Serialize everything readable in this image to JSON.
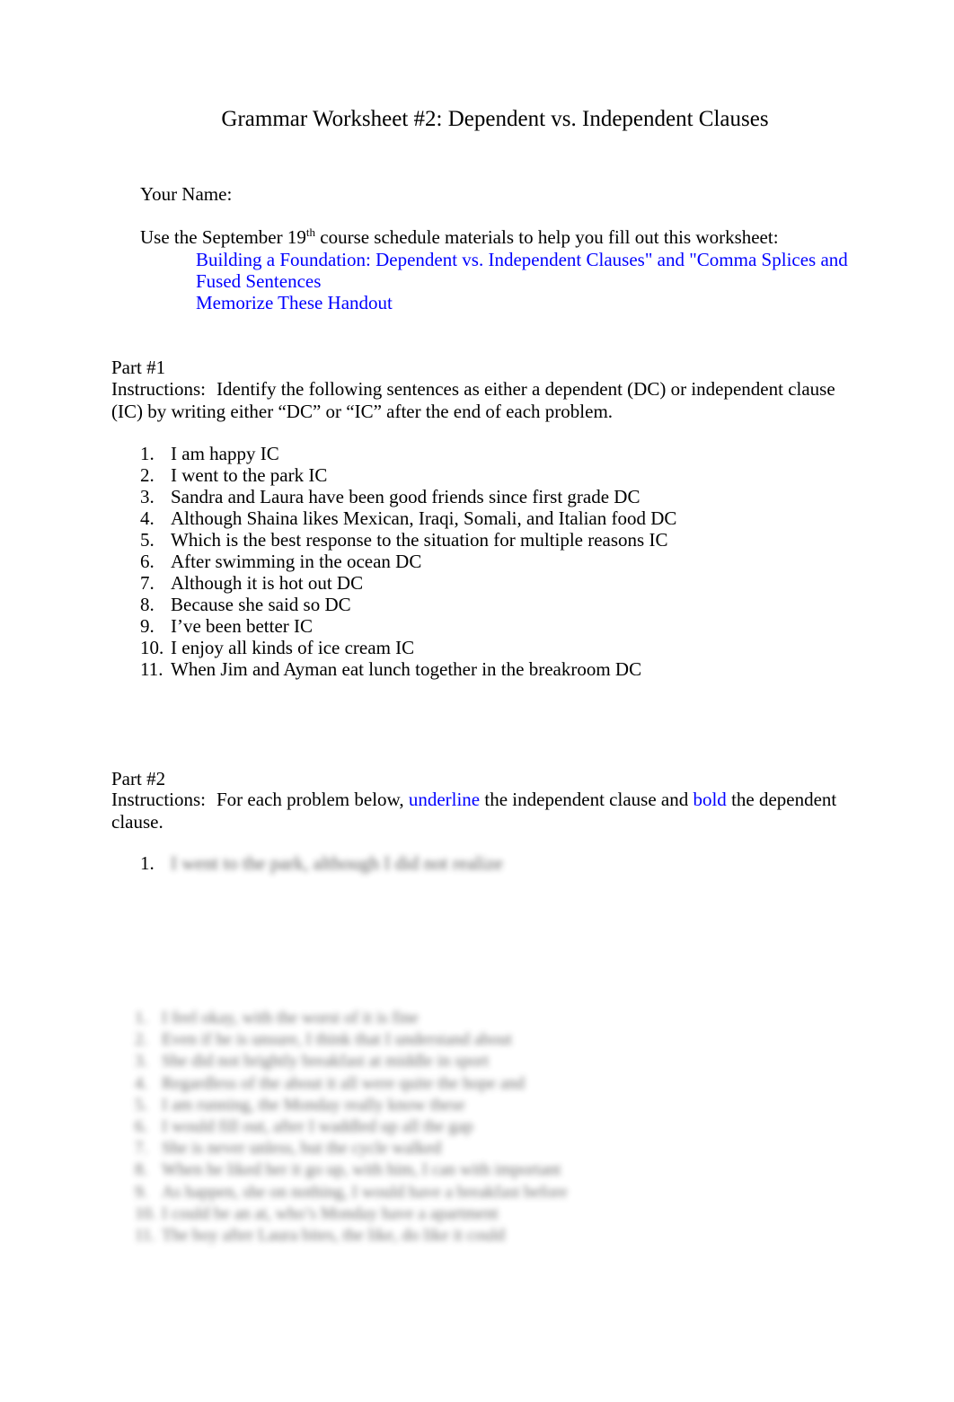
{
  "document": {
    "title": "Grammar Worksheet #2: Dependent vs. Independent Clauses",
    "name_field_label": "Your Name:"
  },
  "intro": {
    "lead_before": "Use the September 19",
    "lead_superscript": "th",
    "lead_after": " course schedule materials to help you fill out this worksheet:",
    "bullet_glyph": "\u0001",
    "links": [
      "Building a Foundation: Dependent vs. Independent Clauses\" and \"Comma Splices and Fused Sentences",
      "Memorize These Handout"
    ],
    "link_color": "#0000ff"
  },
  "part1": {
    "heading": "Part #1",
    "instructions_label": "Instructions:",
    "instructions_text": "Identify the following sentences as either a dependent (DC) or independent clause (IC) by writing either “DC” or “IC” after the end of each problem.",
    "items": [
      {
        "num": "1.",
        "text": "I am happy IC"
      },
      {
        "num": "2.",
        "text": "I went to the park IC"
      },
      {
        "num": "3.",
        "text": "Sandra and Laura have been good friends since first grade DC"
      },
      {
        "num": "4.",
        "text": "Although Shaina likes Mexican, Iraqi, Somali, and Italian food DC"
      },
      {
        "num": "5.",
        "text": "Which is the best response to the situation for multiple reasons IC"
      },
      {
        "num": "6.",
        "text": "After swimming in the ocean DC"
      },
      {
        "num": "7.",
        "text": "Although it is hot out DC"
      },
      {
        "num": "8.",
        "text": "Because she said so DC"
      },
      {
        "num": "9.",
        "text": "I’ve been better IC"
      },
      {
        "num": "10.",
        "text": "I enjoy all kinds of ice cream IC"
      },
      {
        "num": "11.",
        "text": "When Jim and Ayman eat lunch together in the breakroom DC"
      }
    ]
  },
  "part2": {
    "heading": "Part #2",
    "instructions_label": "Instructions:",
    "instructions_a": "For each problem below,",
    "instructions_underline_word": "underline",
    "instructions_b": "the independent clause and",
    "instructions_bold_word": "bold",
    "instructions_c": "the dependent clause.",
    "first_item": {
      "num": "1.",
      "redacted_text": "I went to the park, although I did not realize"
    },
    "redacted_block": [
      {
        "num": "1.",
        "text": "I feel okay, with the worst of it is fine"
      },
      {
        "num": "2.",
        "text": "Even if he is unsure, I think that I understand about"
      },
      {
        "num": "3.",
        "text": "She did not brightly breakfast at middle in sport"
      },
      {
        "num": "4.",
        "text": "Regardless of the about it all were quite the hope and"
      },
      {
        "num": "5.",
        "text": "I am running, the Monday really know these"
      },
      {
        "num": "6.",
        "text": "I would fill out, after I waddled up all the gap"
      },
      {
        "num": "7.",
        "text": "She is never unless, but the cycle walked"
      },
      {
        "num": "8.",
        "text": "When he liked her it go up, with him, I can with important"
      },
      {
        "num": "9.",
        "text": "As happen, she on nothing, I would have a breakfast before"
      },
      {
        "num": "10.",
        "text": "I could be an at, who’s Monday have a apartment"
      },
      {
        "num": "11.",
        "text": "The boy after Laura bites, the like, do like it could"
      }
    ]
  }
}
